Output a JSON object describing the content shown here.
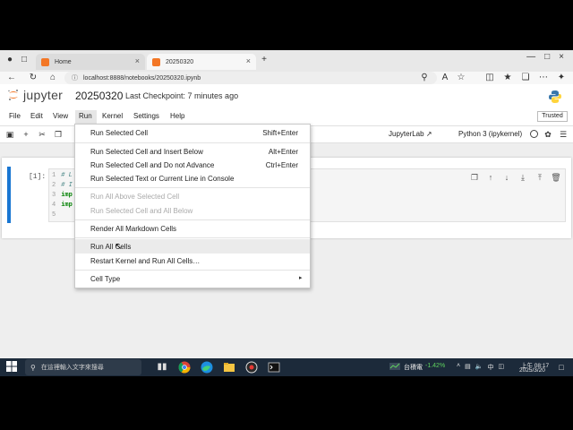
{
  "browser": {
    "tabs": [
      {
        "label": "Home"
      },
      {
        "label": "20250320"
      }
    ],
    "new_tab": "+",
    "url": "localhost:8888/notebooks/20250320.ipynb"
  },
  "jupyter": {
    "logo_text": "jupyter",
    "notebook_name": "20250320",
    "checkpoint": "Last Checkpoint: 7 minutes ago",
    "trusted": "Trusted",
    "menu": [
      "File",
      "Edit",
      "View",
      "Run",
      "Kernel",
      "Settings",
      "Help"
    ],
    "toolbar": {
      "jupyterlab_link": "JupyterLab",
      "kernel": "Python 3 (ipykernel)"
    },
    "cell": {
      "prompt": "[1]:",
      "lines": [
        {
          "num": "1",
          "text": "# L",
          "kind": "comment"
        },
        {
          "num": "2",
          "text": "# I",
          "kind": "comment"
        },
        {
          "num": "3",
          "text": "imp",
          "kind": "keyword"
        },
        {
          "num": "4",
          "text": "imp",
          "kind": "keyword"
        },
        {
          "num": "5",
          "text": "",
          "kind": "plain"
        }
      ]
    }
  },
  "run_menu": {
    "items": [
      {
        "label": "Run Selected Cell",
        "shortcut": "Shift+Enter",
        "enabled": true
      },
      {
        "label": "Run Selected Cell and Insert Below",
        "shortcut": "Alt+Enter",
        "enabled": true
      },
      {
        "label": "Run Selected Cell and Do not Advance",
        "shortcut": "Ctrl+Enter",
        "enabled": true
      },
      {
        "label": "Run Selected Text or Current Line in Console",
        "shortcut": "",
        "enabled": true
      },
      {
        "label": "Run All Above Selected Cell",
        "shortcut": "",
        "enabled": false
      },
      {
        "label": "Run Selected Cell and All Below",
        "shortcut": "",
        "enabled": false
      },
      {
        "label": "Render All Markdown Cells",
        "shortcut": "",
        "enabled": true
      },
      {
        "label": "Run All Cells",
        "shortcut": "",
        "enabled": true,
        "hovered": true
      },
      {
        "label": "Restart Kernel and Run All Cells…",
        "shortcut": "",
        "enabled": true
      },
      {
        "label": "Cell Type",
        "shortcut": "",
        "enabled": true,
        "submenu": true
      }
    ]
  },
  "taskbar": {
    "search_placeholder": "在這裡輸入文字來搜尋",
    "stock_name": "台積電",
    "stock_change": "-1.42%",
    "tray_lang": "中",
    "clock_time": "上午 08:17",
    "clock_date": "2025/3/20"
  },
  "colors": {
    "cell_indicator": "#1976d2",
    "jupyter_orange": "#f37726",
    "stock_down": "#5fd35f",
    "taskbar": "#1c2a3a"
  }
}
